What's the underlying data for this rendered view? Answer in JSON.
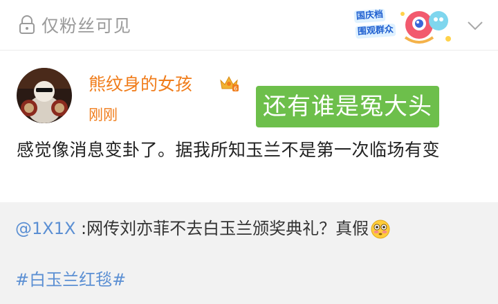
{
  "top_bar": {
    "visibility_label": "仅粉丝可见",
    "badge_text1": "国庆档",
    "badge_text2": "围观群众"
  },
  "post": {
    "username": "熊纹身的女孩",
    "timestamp": "刚刚",
    "overlay_caption": "还有谁是冤大头",
    "body": "感觉像消息变卦了。据我所知玉兰不是第一次临场有变"
  },
  "repost": {
    "mention": "@1X1X",
    "text": " :网传刘亦菲不去白玉兰颁奖典礼？真假",
    "emoji": "flushed-emoji",
    "hashtag": "#白玉兰红毯#"
  },
  "colors": {
    "username": "#f07c1a",
    "link": "#5b8fd3",
    "caption_bg": "#6dbf4b"
  }
}
